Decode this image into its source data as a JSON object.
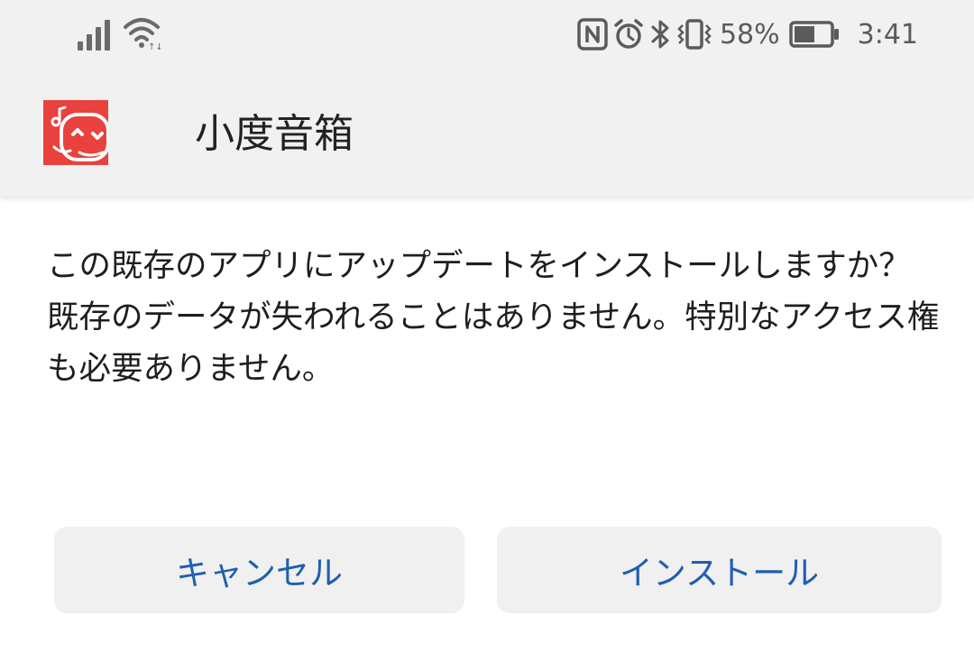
{
  "status_bar": {
    "icons": [
      "signal-icon",
      "wifi-icon",
      "nfc-icon",
      "alarm-icon",
      "bluetooth-icon",
      "vibrate-icon",
      "battery-icon"
    ],
    "battery_percent": "58%",
    "time": "3:41"
  },
  "header": {
    "app_icon": "xiaodu-app-icon",
    "app_name": "小度音箱",
    "background": "#f1f1f1"
  },
  "dialog": {
    "message": "この既存のアプリにアップデートをインストールしますか？既存のデータが失われることはありません。特別なアクセス権も必要ありません。"
  },
  "buttons": {
    "cancel_label": "キャンセル",
    "install_label": "インストール",
    "label_color": "#1f5fb0",
    "background": "#f0f0f0"
  },
  "colors": {
    "app_icon_red": "#e8413e"
  }
}
